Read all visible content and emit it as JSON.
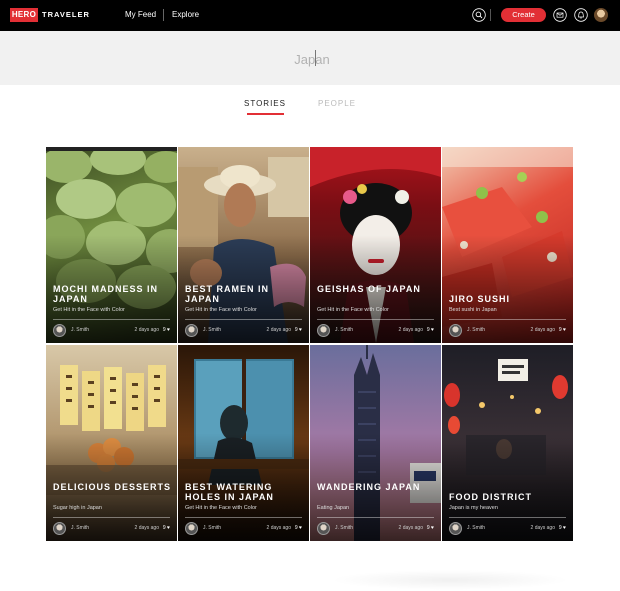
{
  "nav": {
    "logo_box": "HERO",
    "logo_text": "TRAVELER",
    "my_feed": "My Feed",
    "explore": "Explore",
    "create": "Create",
    "icons": [
      "search-icon",
      "mail-icon",
      "bell-icon"
    ]
  },
  "search": {
    "value": "Japan"
  },
  "tabs": [
    {
      "label": "STORIES",
      "active": true
    },
    {
      "label": "PEOPLE",
      "active": false
    }
  ],
  "stories": [
    {
      "title": "MOCHI MADNESS IN JAPAN",
      "subtitle": "Get Hit in the Face with Color",
      "author": "J. Smith",
      "time": "2 days ago",
      "likes": "9"
    },
    {
      "title": "BEST RAMEN IN JAPAN",
      "subtitle": "Get Hit in the Face with Color",
      "author": "J. Smith",
      "time": "2 days ago",
      "likes": "9"
    },
    {
      "title": "GEISHAS OF JAPAN",
      "subtitle": "Get Hit in the Face with Color",
      "author": "J. Smith",
      "time": "2 days ago",
      "likes": "9"
    },
    {
      "title": "JIRO SUSHI",
      "subtitle": "Best sushi in Japan",
      "author": "J. Smith",
      "time": "2 days ago",
      "likes": "9"
    },
    {
      "title": "DELICIOUS DESSERTS",
      "subtitle": "Sugar high in Japan",
      "author": "J. Smith",
      "time": "2 days ago",
      "likes": "9"
    },
    {
      "title": "BEST WATERING HOLES IN JAPAN",
      "subtitle": "Get Hit in the Face with Color",
      "author": "J. Smith",
      "time": "2 days ago",
      "likes": "9"
    },
    {
      "title": "WANDERING JAPAN",
      "subtitle": "Eating Japan",
      "author": "J. Smith",
      "time": "2 days ago",
      "likes": "9"
    },
    {
      "title": "FOOD DISTRICT",
      "subtitle": "Japan is my heaven",
      "author": "J. Smith",
      "time": "2 days ago",
      "likes": "9"
    }
  ],
  "colors": {
    "accent": "#e22f35",
    "nav_bg": "#000000",
    "search_bg": "#f1f1f1"
  }
}
